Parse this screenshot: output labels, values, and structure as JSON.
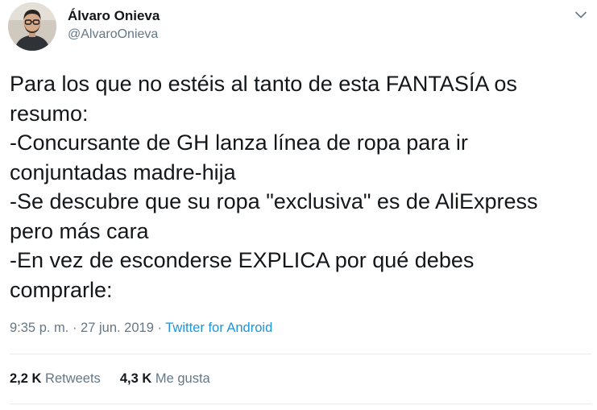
{
  "author": {
    "name": "Álvaro Onieva",
    "handle": "@AlvaroOnieva"
  },
  "tweet": {
    "lines": [
      "Para los que no estéis al tanto de esta FANTASÍA os",
      "resumo:",
      "-Concursante de GH lanza línea de ropa para ir",
      "conjuntadas madre-hija",
      "-Se descubre que su ropa \"exclusiva\" es de AliExpress",
      "pero más cara",
      "-En vez de esconderse EXPLICA por qué debes",
      "comprarle:"
    ],
    "time": "9:35 p. m.",
    "separator1": " · ",
    "date": "27 jun. 2019",
    "separator2": " · ",
    "source": "Twitter for Android"
  },
  "stats": {
    "retweets_count": "2,2 K",
    "retweets_label": "Retweets",
    "likes_count": "4,3 K",
    "likes_label": "Me gusta"
  },
  "icons": {
    "menu": "chevron-down-icon",
    "avatar": "profile-photo"
  },
  "colors": {
    "text": "#14171a",
    "secondary": "#657786",
    "link": "#1b95e0",
    "divider": "#e6ecf0"
  }
}
